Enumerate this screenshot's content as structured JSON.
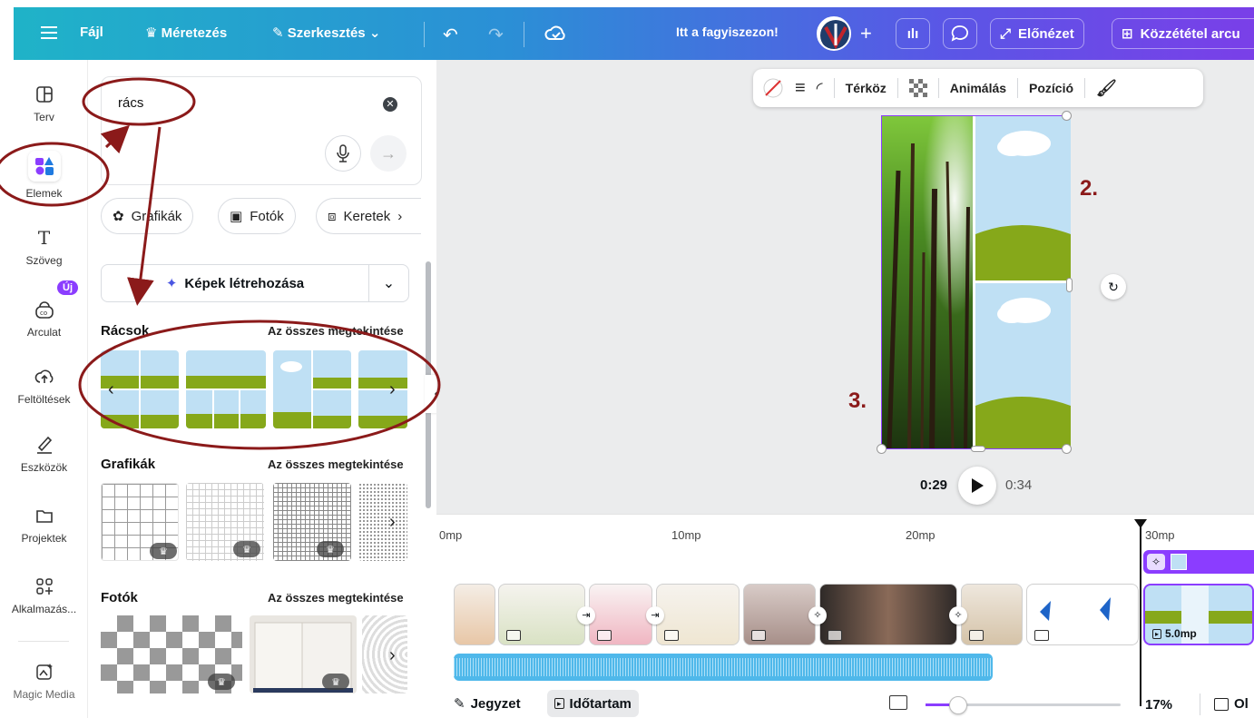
{
  "topbar": {
    "file": "Fájl",
    "resize": "Méretezés",
    "edit": "Szerkesztés",
    "design_title": "Itt a fagyiszezon!",
    "preview": "Előnézet",
    "publish": "Közzététel arcu"
  },
  "rail": {
    "items": [
      {
        "label": "Terv"
      },
      {
        "label": "Elemek"
      },
      {
        "label": "Szöveg"
      },
      {
        "label": "Arculat",
        "badge": "Új"
      },
      {
        "label": "Feltöltések"
      },
      {
        "label": "Eszközök"
      },
      {
        "label": "Projektek"
      },
      {
        "label": "Alkalmazás..."
      },
      {
        "label": "Magic Media"
      }
    ]
  },
  "panel": {
    "search_value": "rács",
    "chips": [
      "Grafikák",
      "Fotók",
      "Keretek"
    ],
    "generate": "Képek létrehozása",
    "sections": [
      {
        "title": "Rácsok",
        "link": "Az összes megtekintése"
      },
      {
        "title": "Grafikák",
        "link": "Az összes megtekintése"
      },
      {
        "title": "Fotók",
        "link": "Az összes megtekintése"
      }
    ]
  },
  "context_toolbar": {
    "spacing": "Térköz",
    "animate": "Animálás",
    "position": "Pozíció"
  },
  "playback": {
    "current": "0:29",
    "total": "0:34"
  },
  "timeline": {
    "ruler": [
      "0mp",
      "10mp",
      "20mp",
      "30mp"
    ],
    "clip_duration": "5.0mp",
    "notes": "Jegyzet",
    "duration": "Időtartam",
    "zoom": "17%",
    "view_fragment": "Ol"
  },
  "annotations": {
    "label_2": "2.",
    "label_3": "3."
  },
  "colors": {
    "accent_purple": "#8b3dff",
    "annotation_red": "#8b1a1a",
    "teal_start": "#1fb3c8"
  }
}
